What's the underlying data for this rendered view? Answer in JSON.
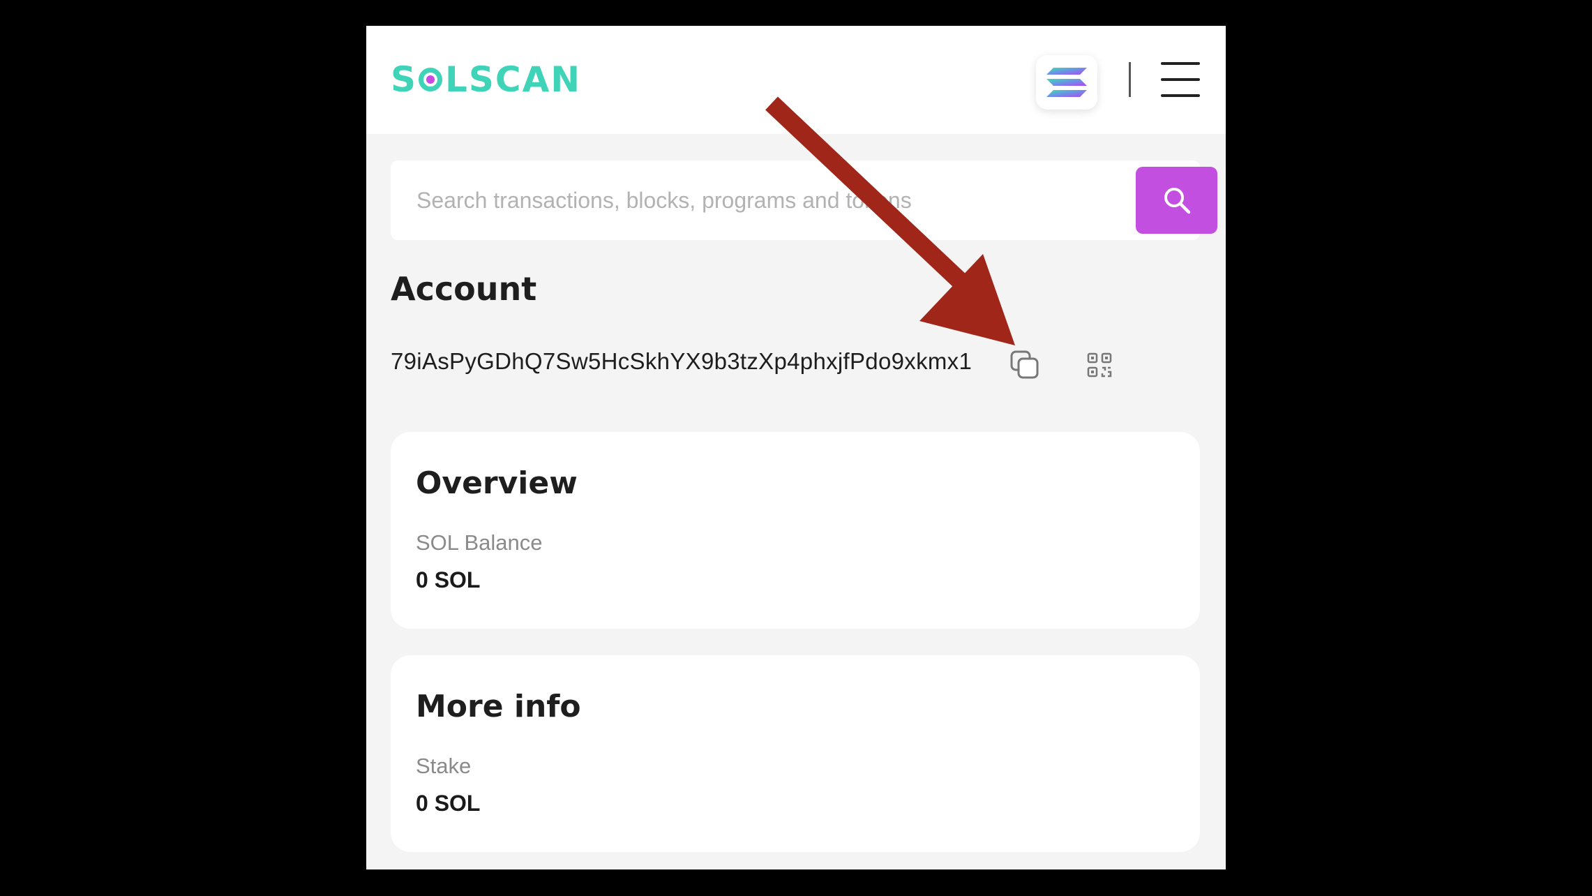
{
  "header": {
    "logo_text_left": "S",
    "logo_text_right": "LSCAN",
    "network_icon": "solana-logo-icon",
    "menu_icon": "hamburger-menu-icon"
  },
  "search": {
    "placeholder": "Search transactions, blocks, programs and tokens",
    "button_icon": "search-icon"
  },
  "account": {
    "title": "Account",
    "address": "79iAsPyGDhQ7Sw5HcSkhYX9b3tzXp4phxjfPdo9xkmx1",
    "copy_icon": "copy-icon",
    "qr_icon": "qr-code-icon"
  },
  "overview": {
    "title": "Overview",
    "label": "SOL Balance",
    "value": "0 SOL"
  },
  "more_info": {
    "title": "More info",
    "label": "Stake",
    "value": "0 SOL"
  },
  "annotation": {
    "arrow_color": "#a0261a",
    "points_to": "copy-icon"
  },
  "colors": {
    "brand_teal": "#3fd3b8",
    "brand_purple": "#c24fe0",
    "background": "#f4f4f4"
  }
}
